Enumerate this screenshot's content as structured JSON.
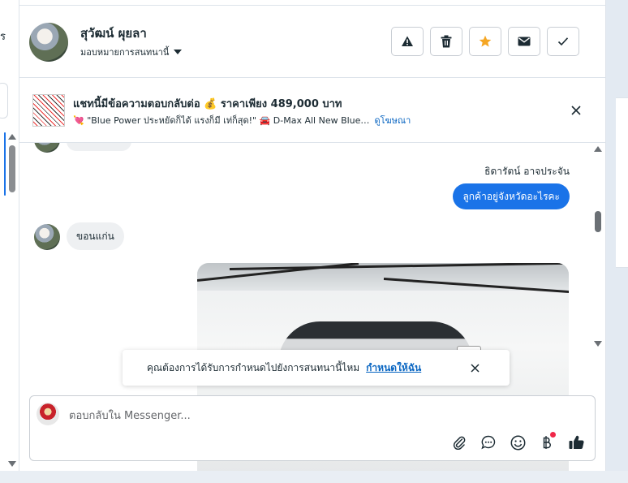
{
  "left_panel": {
    "fragment_text": "ร"
  },
  "header": {
    "contact_name": "สุวัฒน์ ผุยลา",
    "assign_label": "มอบหมายการสนทนานี้",
    "actions": [
      {
        "name": "report-spam",
        "icon": "warning-icon"
      },
      {
        "name": "delete",
        "icon": "trash-icon"
      },
      {
        "name": "follow-up",
        "icon": "star-icon",
        "color": "#f5a623"
      },
      {
        "name": "mark-unread",
        "icon": "envelope-icon"
      },
      {
        "name": "mark-done",
        "icon": "check-icon"
      }
    ]
  },
  "ad_banner": {
    "title": "แชทนี้มีข้อความตอบกลับต่อ 💰 ราคาเพียง 489,000 บาท",
    "description": "💘 \"Blue Power ประหยัดก็ได้ แรงก็มี เท่ก็สุด!\" 🚘 D-Max All New Blue…",
    "view_ad_link": "ดูโฆษณา"
  },
  "messages": [
    {
      "direction": "outgoing",
      "sender": "ธิดารัตน์ อาจประจัน",
      "text": "ลูกค้าอยู่จังหวัดอะไรคะ"
    },
    {
      "direction": "incoming",
      "text": "ขอนแก่น"
    },
    {
      "direction": "outgoing",
      "type": "image",
      "text": ""
    }
  ],
  "toast": {
    "text": "คุณต้องการได้รับการกำหนดไปยังการสนทนานี้ไหม",
    "action_label": "กำหนดให้ฉัน"
  },
  "composer": {
    "placeholder": "ตอบกลับใน Messenger...",
    "tools": [
      "paperclip-icon",
      "saved-reply-icon",
      "emoji-icon",
      "baht-payment-icon",
      "thumbs-up-icon"
    ]
  },
  "colors": {
    "accent": "#1a73e8",
    "link": "#0a66c2",
    "star": "#f5a623",
    "notification_dot": "#f02849"
  }
}
